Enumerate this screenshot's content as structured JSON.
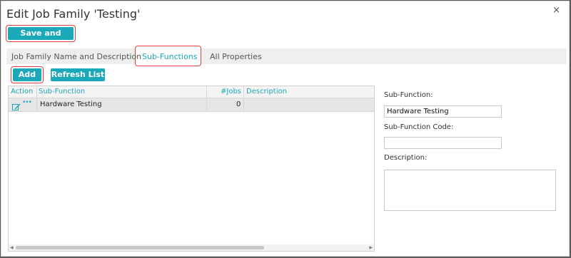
{
  "dialog": {
    "title": "Edit Job Family 'Testing'",
    "close_glyph": "×"
  },
  "toolbar": {
    "save_close_label": "Save and Close"
  },
  "tabs": [
    {
      "label": "Job Family Name and Description",
      "active": false
    },
    {
      "label": "Sub-Functions",
      "active": true
    },
    {
      "label": "All Properties",
      "active": false
    }
  ],
  "actions": {
    "add_label": "Add",
    "refresh_label": "Refresh List"
  },
  "grid": {
    "columns": [
      "Action",
      "Sub-Function",
      "#Jobs",
      "Description"
    ],
    "rows": [
      {
        "subfunction": "Hardware Testing",
        "jobs": "0",
        "description": ""
      }
    ],
    "more_glyph": "•••"
  },
  "form": {
    "subfunction_label": "Sub-Function:",
    "subfunction_value": "Hardware Testing",
    "code_label": "Sub-Function Code:",
    "code_value": "",
    "description_label": "Description:",
    "description_value": ""
  },
  "colors": {
    "accent": "#1ba8b8",
    "highlight": "#e04040"
  },
  "icons": [
    "close-icon",
    "edit-icon",
    "more-icon",
    "scroll-left-icon",
    "scroll-right-icon"
  ]
}
